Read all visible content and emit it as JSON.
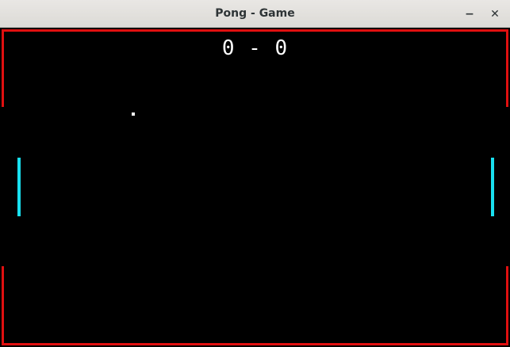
{
  "window": {
    "title": "Pong - Game",
    "minimize_glyph": "−",
    "close_glyph": "✕"
  },
  "game": {
    "score_left": 0,
    "score_right": 0,
    "score_text": "0 - 0",
    "colors": {
      "background": "#000000",
      "wall": "#e01010",
      "paddle": "#19e0f0",
      "ball": "#ffffff",
      "score": "#ffffff"
    }
  }
}
